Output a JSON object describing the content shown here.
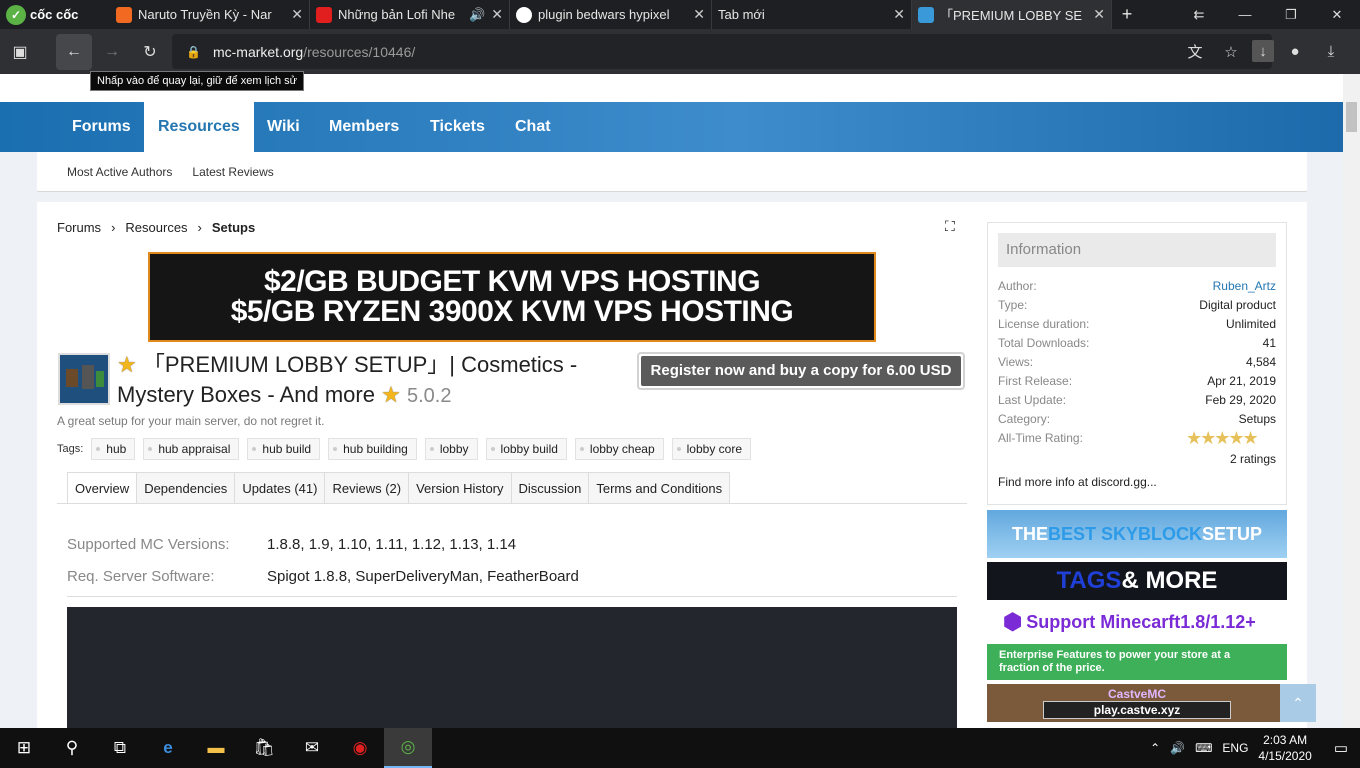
{
  "browser": {
    "brand": "cốc cốc",
    "tabs": [
      {
        "title": "Naruto Truyền Kỳ - Nar",
        "favicon_color": "#f26a22"
      },
      {
        "title": "Những bản Lofi Nhe",
        "favicon_color": "#e11f1f"
      },
      {
        "title": "plugin bedwars hypixel",
        "favicon_color": "#ffffff"
      },
      {
        "title": "Tab mới",
        "favicon_color": "#2f3033"
      },
      {
        "title": "「PREMIUM LOBBY SE",
        "favicon_color": "#3a9ad9"
      }
    ],
    "new_tab": "+",
    "url_host": "mc-market.org",
    "url_path": "/resources/10446/",
    "tooltip": "Nhấp vào để quay lại, giữ để xem lịch sử"
  },
  "nav": {
    "items": [
      "Forums",
      "Resources",
      "Wiki",
      "Members",
      "Tickets",
      "Chat"
    ],
    "active": "Resources",
    "sub": [
      "Most Active Authors",
      "Latest Reviews"
    ]
  },
  "breadcrumb": [
    "Forums",
    "Resources",
    "Setups"
  ],
  "banner": {
    "line1": "$2/GB BUDGET KVM VPS HOSTING",
    "line2": "$5/GB RYZEN 3900X KVM VPS HOSTING"
  },
  "resource": {
    "title": "「PREMIUM LOBBY SETUP」| Cosmetics - Mystery Boxes - And more",
    "version": "5.0.2",
    "tagline": "A great setup for your main server, do not regret it.",
    "buy_label": "Register now and buy a copy for 6.00 USD",
    "tags_label": "Tags:",
    "tags": [
      "hub",
      "hub appraisal",
      "hub build",
      "hub building",
      "lobby",
      "lobby build",
      "lobby cheap",
      "lobby core"
    ],
    "tabs": [
      "Overview",
      "Dependencies",
      "Updates (41)",
      "Reviews (2)",
      "Version History",
      "Discussion",
      "Terms and Conditions"
    ],
    "active_tab": "Overview",
    "fields": [
      {
        "k": "Supported MC Versions:",
        "v": "1.8.8, 1.9, 1.10, 1.11, 1.12, 1.13, 1.14"
      },
      {
        "k": "Req. Server Software:",
        "v": "Spigot 1.8.8, SuperDeliveryMan, FeatherBoard"
      }
    ]
  },
  "info": {
    "title": "Information",
    "rows": [
      {
        "k": "Author:",
        "v": "Ruben_Artz",
        "link": true
      },
      {
        "k": "Type:",
        "v": "Digital product"
      },
      {
        "k": "License duration:",
        "v": "Unlimited"
      },
      {
        "k": "Total Downloads:",
        "v": "41"
      },
      {
        "k": "Views:",
        "v": "4,584"
      },
      {
        "k": "First Release:",
        "v": "Apr 21, 2019"
      },
      {
        "k": "Last Update:",
        "v": "Feb 29, 2020"
      },
      {
        "k": "Category:",
        "v": "Setups"
      },
      {
        "k": "All-Time Rating:",
        "v": ""
      }
    ],
    "rating_stars": 5,
    "rating_count": "2 ratings",
    "more": "Find more info at discord.gg..."
  },
  "ads": {
    "a1_part1": "THE ",
    "a1_part2": "BEST SKYBLOCK",
    "a1_part3": " SETUP",
    "a2_part1": "TAGS",
    "a2_part2": " & MORE",
    "a3": "Support Minecarft1.8/1.12+",
    "a4": "Enterprise Features to power your store at a fraction of the price.",
    "a5_title": "CastveMC",
    "a5_sub": "play.castve.xyz"
  },
  "taskbar": {
    "lang": "ENG",
    "time": "2:03 AM",
    "date": "4/15/2020"
  }
}
